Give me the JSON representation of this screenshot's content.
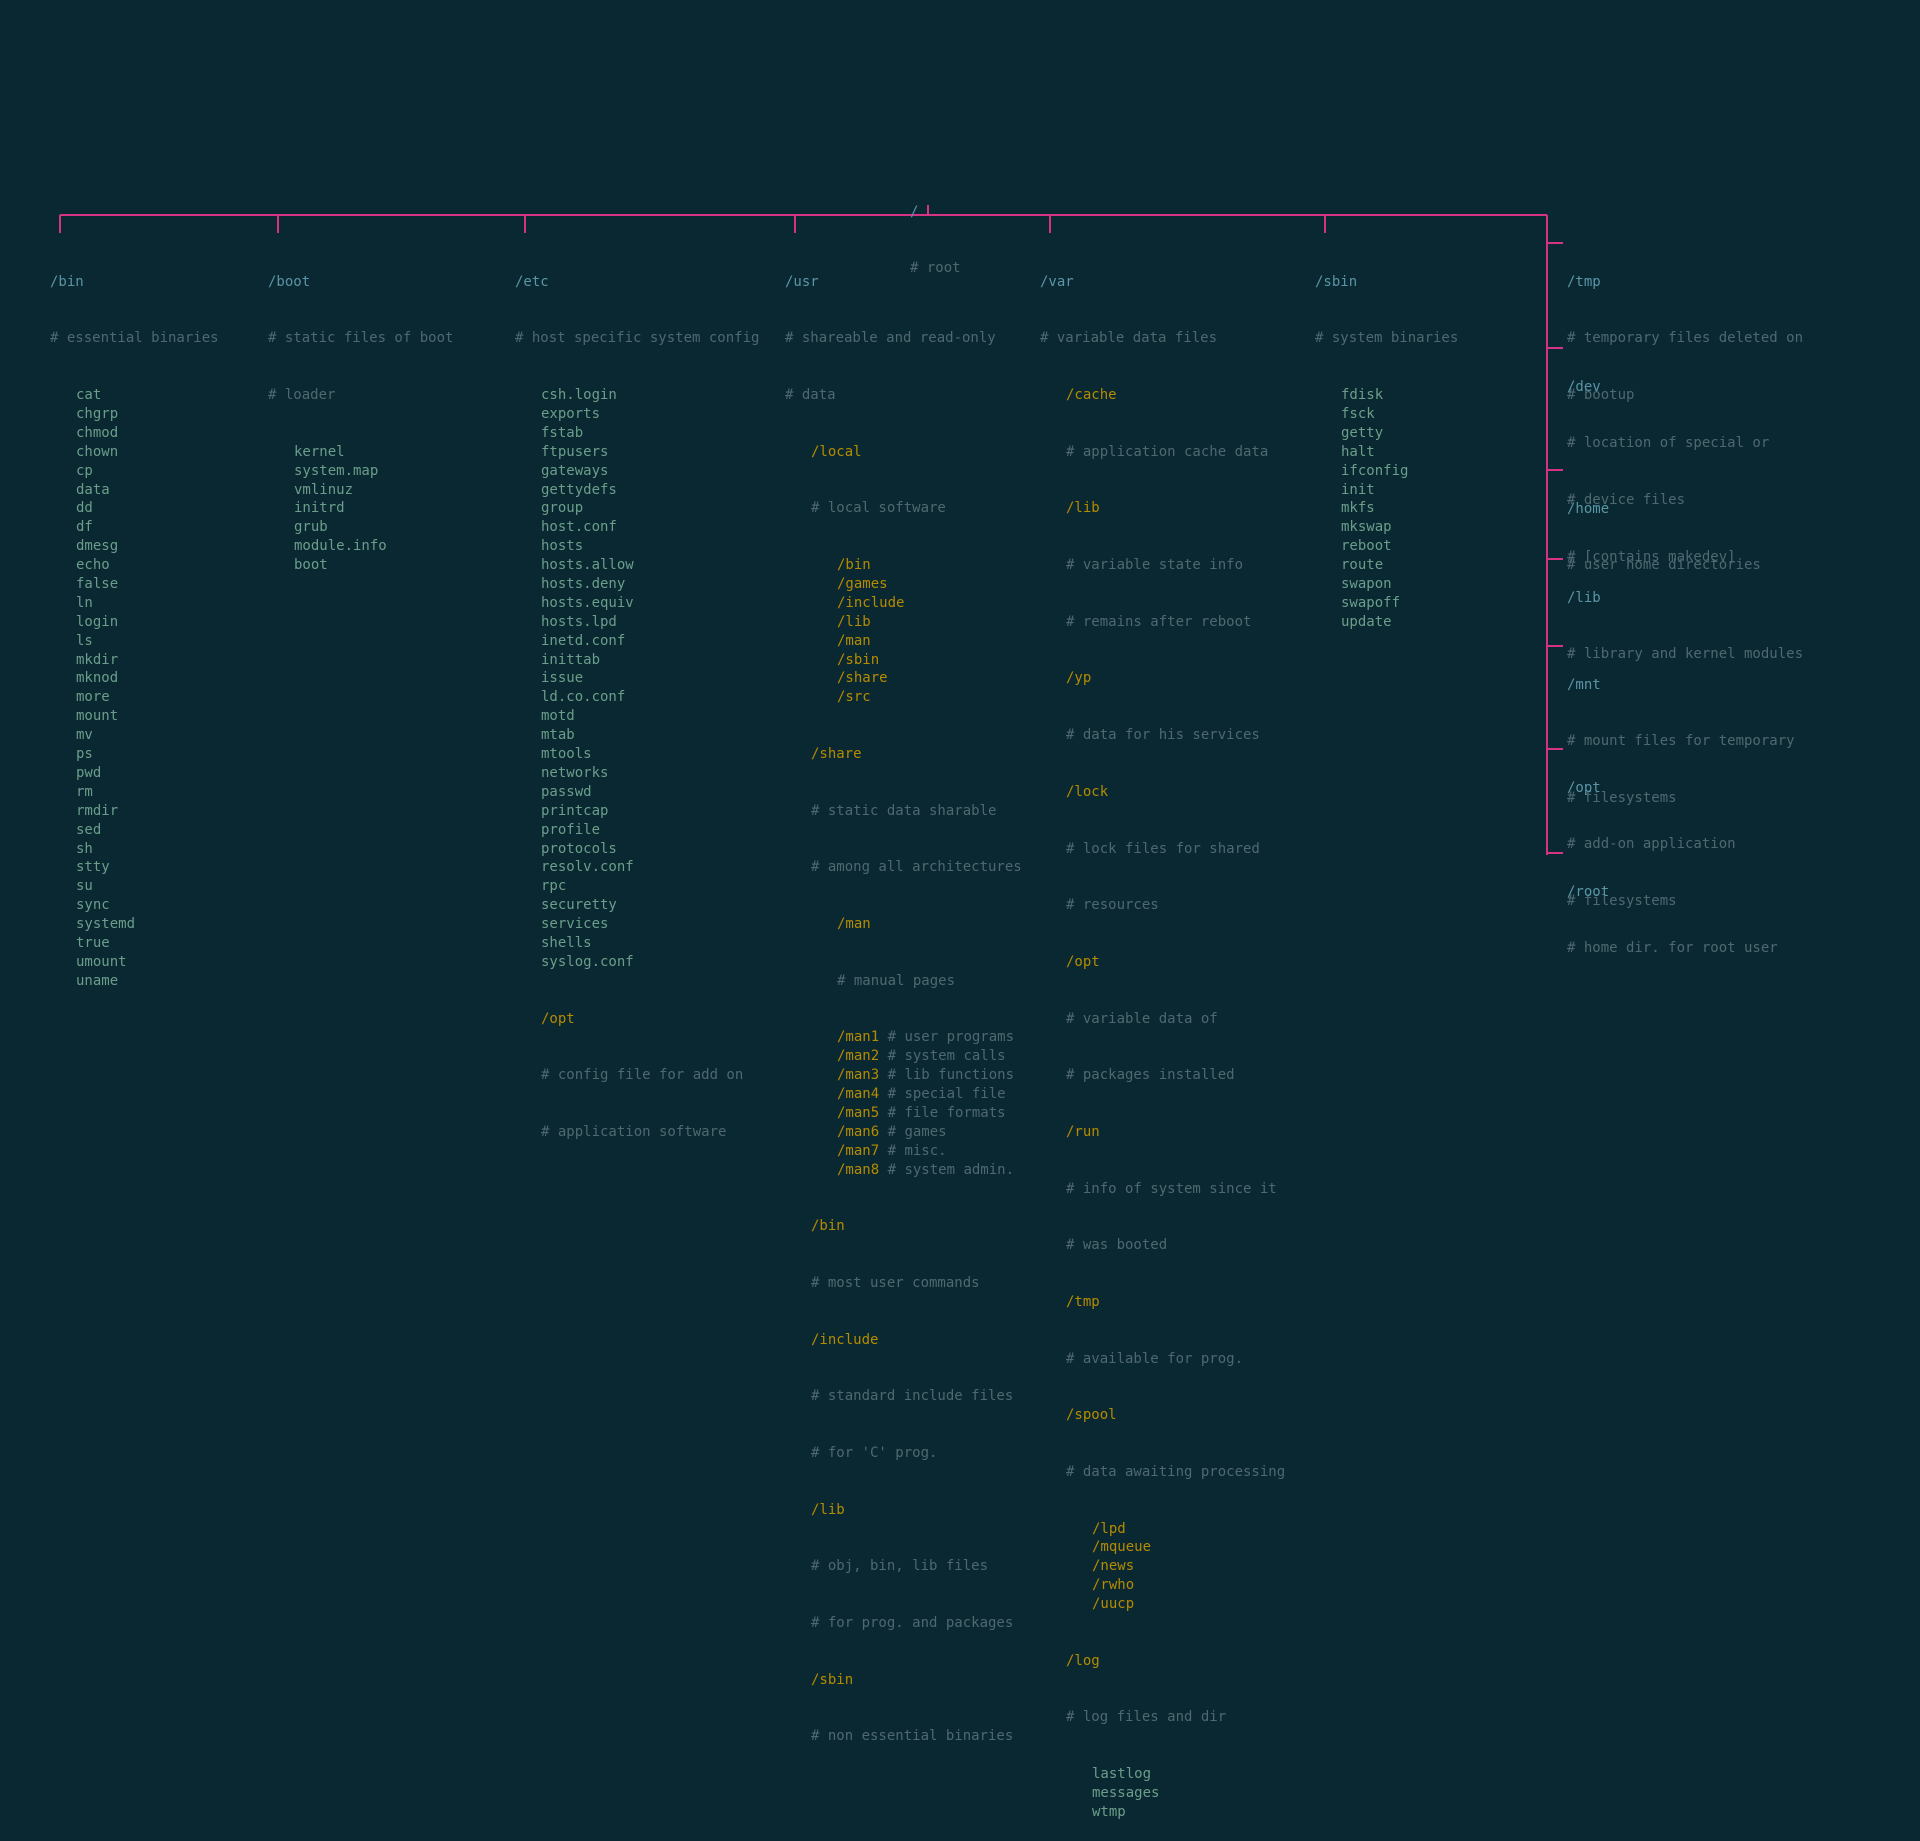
{
  "root": {
    "path": "/",
    "comment": "# root"
  },
  "columns": {
    "bin": {
      "name": "/bin",
      "comment": "# essential binaries",
      "items": [
        "cat",
        "chgrp",
        "chmod",
        "chown",
        "cp",
        "data",
        "dd",
        "df",
        "dmesg",
        "echo",
        "false",
        "ln",
        "login",
        "ls",
        "mkdir",
        "mknod",
        "more",
        "mount",
        "mv",
        "ps",
        "pwd",
        "rm",
        "rmdir",
        "sed",
        "sh",
        "stty",
        "su",
        "sync",
        "systemd",
        "true",
        "umount",
        "uname"
      ]
    },
    "boot": {
      "name": "/boot",
      "comment": "# static files of boot",
      "loader_comment": "# loader",
      "items": [
        "kernel",
        "system.map",
        "vmlinuz",
        "initrd",
        "grub",
        "module.info",
        "boot"
      ]
    },
    "etc": {
      "name": "/etc",
      "comment": "# host specific system config",
      "items": [
        "csh.login",
        "exports",
        "fstab",
        "ftpusers",
        "gateways",
        "gettydefs",
        "group",
        "host.conf",
        "hosts",
        "hosts.allow",
        "hosts.deny",
        "hosts.equiv",
        "hosts.lpd",
        "inetd.conf",
        "inittab",
        "issue",
        "ld.co.conf",
        "motd",
        "mtab",
        "mtools",
        "networks",
        "passwd",
        "printcap",
        "profile",
        "protocols",
        "resolv.conf",
        "rpc",
        "securetty",
        "services",
        "shells",
        "syslog.conf"
      ],
      "opt": {
        "name": "/opt",
        "c1": "# config file for add on",
        "c2": "# application software"
      }
    },
    "usr": {
      "name": "/usr",
      "comment": "# shareable and read-only",
      "data_comment": "# data",
      "local": {
        "name": "/local",
        "comment": "# local software",
        "items": [
          "/bin",
          "/games",
          "/include",
          "/lib",
          "/man",
          "/sbin",
          "/share",
          "/src"
        ]
      },
      "share": {
        "name": "/share",
        "c1": "# static data sharable",
        "c2": "# among all architectures",
        "man": {
          "name": "/man",
          "comment": "# manual pages"
        },
        "mans": [
          {
            "d": "/man1",
            "c": "# user programs"
          },
          {
            "d": "/man2",
            "c": "# system calls"
          },
          {
            "d": "/man3",
            "c": "# lib functions"
          },
          {
            "d": "/man4",
            "c": "# special file"
          },
          {
            "d": "/man5",
            "c": "# file formats"
          },
          {
            "d": "/man6",
            "c": "# games"
          },
          {
            "d": "/man7",
            "c": "# misc."
          },
          {
            "d": "/man8",
            "c": "# system admin."
          }
        ]
      },
      "bin": {
        "name": "/bin",
        "c": "# most user commands"
      },
      "include": {
        "name": "/include",
        "c1": "# standard include files",
        "c2": "# for 'C' prog."
      },
      "lib": {
        "name": "/lib",
        "c1": "# obj, bin, lib files",
        "c2": "# for prog. and packages"
      },
      "sbin": {
        "name": "/sbin",
        "c": "# non essential binaries"
      }
    },
    "var": {
      "name": "/var",
      "comment": "# variable data files",
      "cache": {
        "name": "/cache",
        "c": "# application cache data"
      },
      "lib": {
        "name": "/lib",
        "c1": "# variable state info",
        "c2": "# remains after reboot"
      },
      "yp": {
        "name": "/yp",
        "c": "# data for his services"
      },
      "lock": {
        "name": "/lock",
        "c1": "# lock files for shared",
        "c2": "# resources"
      },
      "opt": {
        "name": "/opt",
        "c1": "# variable data of",
        "c2": "# packages installed"
      },
      "run": {
        "name": "/run",
        "c1": "# info of system since it",
        "c2": "# was booted"
      },
      "tmp": {
        "name": "/tmp",
        "c": "# available for prog."
      },
      "spool": {
        "name": "/spool",
        "c": "# data awaiting processing",
        "items": [
          "/lpd",
          "/mqueue",
          "/news",
          "/rwho",
          "/uucp"
        ]
      },
      "log": {
        "name": "/log",
        "c": "# log files and dir",
        "items": [
          "lastlog",
          "messages",
          "wtmp"
        ]
      }
    },
    "sbin": {
      "name": "/sbin",
      "comment": "# system binaries",
      "items": [
        "fdisk",
        "fsck",
        "getty",
        "halt",
        "ifconfig",
        "init",
        "mkfs",
        "mkswap",
        "reboot",
        "route",
        "swapon",
        "swapoff",
        "update"
      ]
    }
  },
  "side": {
    "tmp": {
      "name": "/tmp",
      "c1": "# temporary files deleted on",
      "c2": "# bootup"
    },
    "dev": {
      "name": "/dev",
      "c1": "# location of special or",
      "c2": "# device files",
      "c3": "# [contains makedev]"
    },
    "home": {
      "name": "/home",
      "c": "# user home directories"
    },
    "lib": {
      "name": "/lib",
      "c": "# library and kernel modules"
    },
    "mnt": {
      "name": "/mnt",
      "c1": "# mount files for temporary",
      "c2": "# filesystems"
    },
    "opt": {
      "name": "/opt",
      "c1": "# add-on application",
      "c2": "# filesystems"
    },
    "root": {
      "name": "/root",
      "c": "# home dir. for root user"
    }
  }
}
